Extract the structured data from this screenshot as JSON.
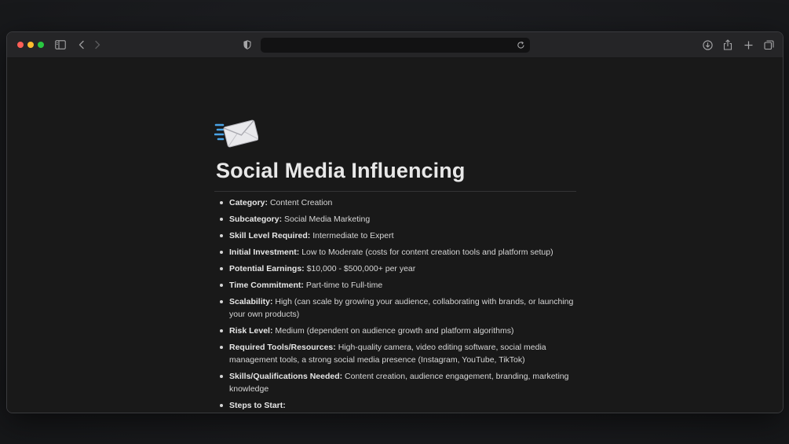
{
  "browser": {
    "address_text": "",
    "icons": {
      "sidebar": "sidebar-toggle-icon",
      "back": "chevron-left-icon",
      "forward": "chevron-right-icon",
      "privacy": "shield-half-icon",
      "reload": "reload-icon",
      "download": "download-icon",
      "share": "share-icon",
      "new_tab": "plus-icon",
      "tabs": "tab-overview-icon"
    }
  },
  "page": {
    "icon": "envelope-with-speed-lines-icon",
    "title": "Social Media Influencing",
    "properties": [
      {
        "label": "Category:",
        "value": "Content Creation"
      },
      {
        "label": "Subcategory:",
        "value": "Social Media Marketing"
      },
      {
        "label": "Skill Level Required:",
        "value": "Intermediate to Expert"
      },
      {
        "label": "Initial Investment:",
        "value": "Low to Moderate (costs for content creation tools and platform setup)"
      },
      {
        "label": "Potential Earnings:",
        "value": "$10,000 - $500,000+ per year"
      },
      {
        "label": "Time Commitment:",
        "value": "Part-time to Full-time"
      },
      {
        "label": "Scalability:",
        "value": "High (can scale by growing your audience, collaborating with brands, or launching your own products)"
      },
      {
        "label": "Risk Level:",
        "value": "Medium (dependent on audience growth and platform algorithms)"
      },
      {
        "label": "Required Tools/Resources:",
        "value": "High-quality camera, video editing software, social media management tools, a strong social media presence (Instagram, YouTube, TikTok)"
      },
      {
        "label": "Skills/Qualifications Needed:",
        "value": "Content creation, audience engagement, branding, marketing knowledge"
      },
      {
        "label": "Steps to Start:",
        "value": ""
      }
    ]
  },
  "colors": {
    "window_bg": "#191919",
    "toolbar_bg": "#252527",
    "text": "#d6d6d6",
    "close": "#ff5f57",
    "minimize": "#febc2e",
    "zoom": "#28c840"
  }
}
